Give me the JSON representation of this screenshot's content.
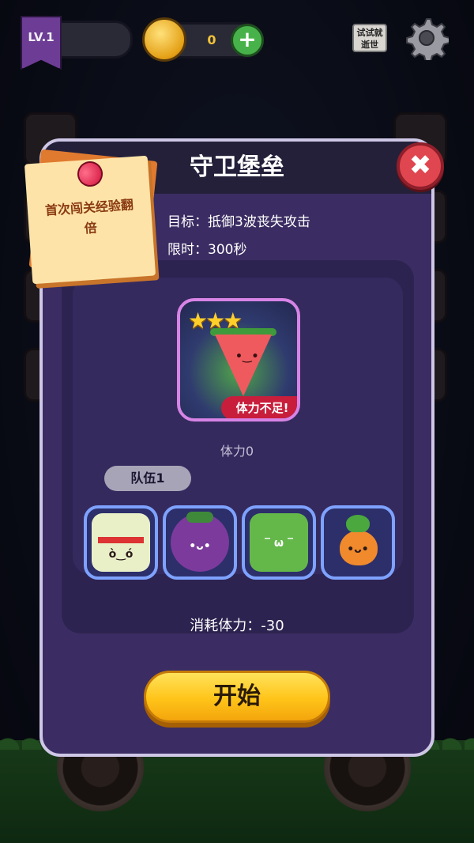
{
  "topbar": {
    "level": "LV.1",
    "coins": "0",
    "plus": "+",
    "trial": "试试就逝世"
  },
  "modal": {
    "title": "守卫堡垒",
    "close": "✖",
    "goal_label": "目标：",
    "goal_value": "抵御3波丧失攻击",
    "time_label": "限时：",
    "time_value": "300秒",
    "note_text": "首次闯关经验翻倍",
    "level_card": {
      "stars": "★★★",
      "badge": "体力不足",
      "badge_mark": "!"
    },
    "stamina": "体力0",
    "team_label": "队伍1",
    "team": [
      {
        "icon": "leek-character-icon",
        "color": "#e9f0c8"
      },
      {
        "icon": "eggplant-character-icon",
        "color": "#7c3a9c"
      },
      {
        "icon": "cucumber-character-icon",
        "color": "#64b84a"
      },
      {
        "icon": "carrot-character-icon",
        "color": "#f08a2c"
      }
    ],
    "cost_label": "消耗体力：",
    "cost_value": "-30",
    "start_label": "开始"
  },
  "colors": {
    "accent": "#ffc419",
    "close": "#e0464f",
    "panel": "#3b2d63",
    "slot_border": "#7ea2ff"
  }
}
